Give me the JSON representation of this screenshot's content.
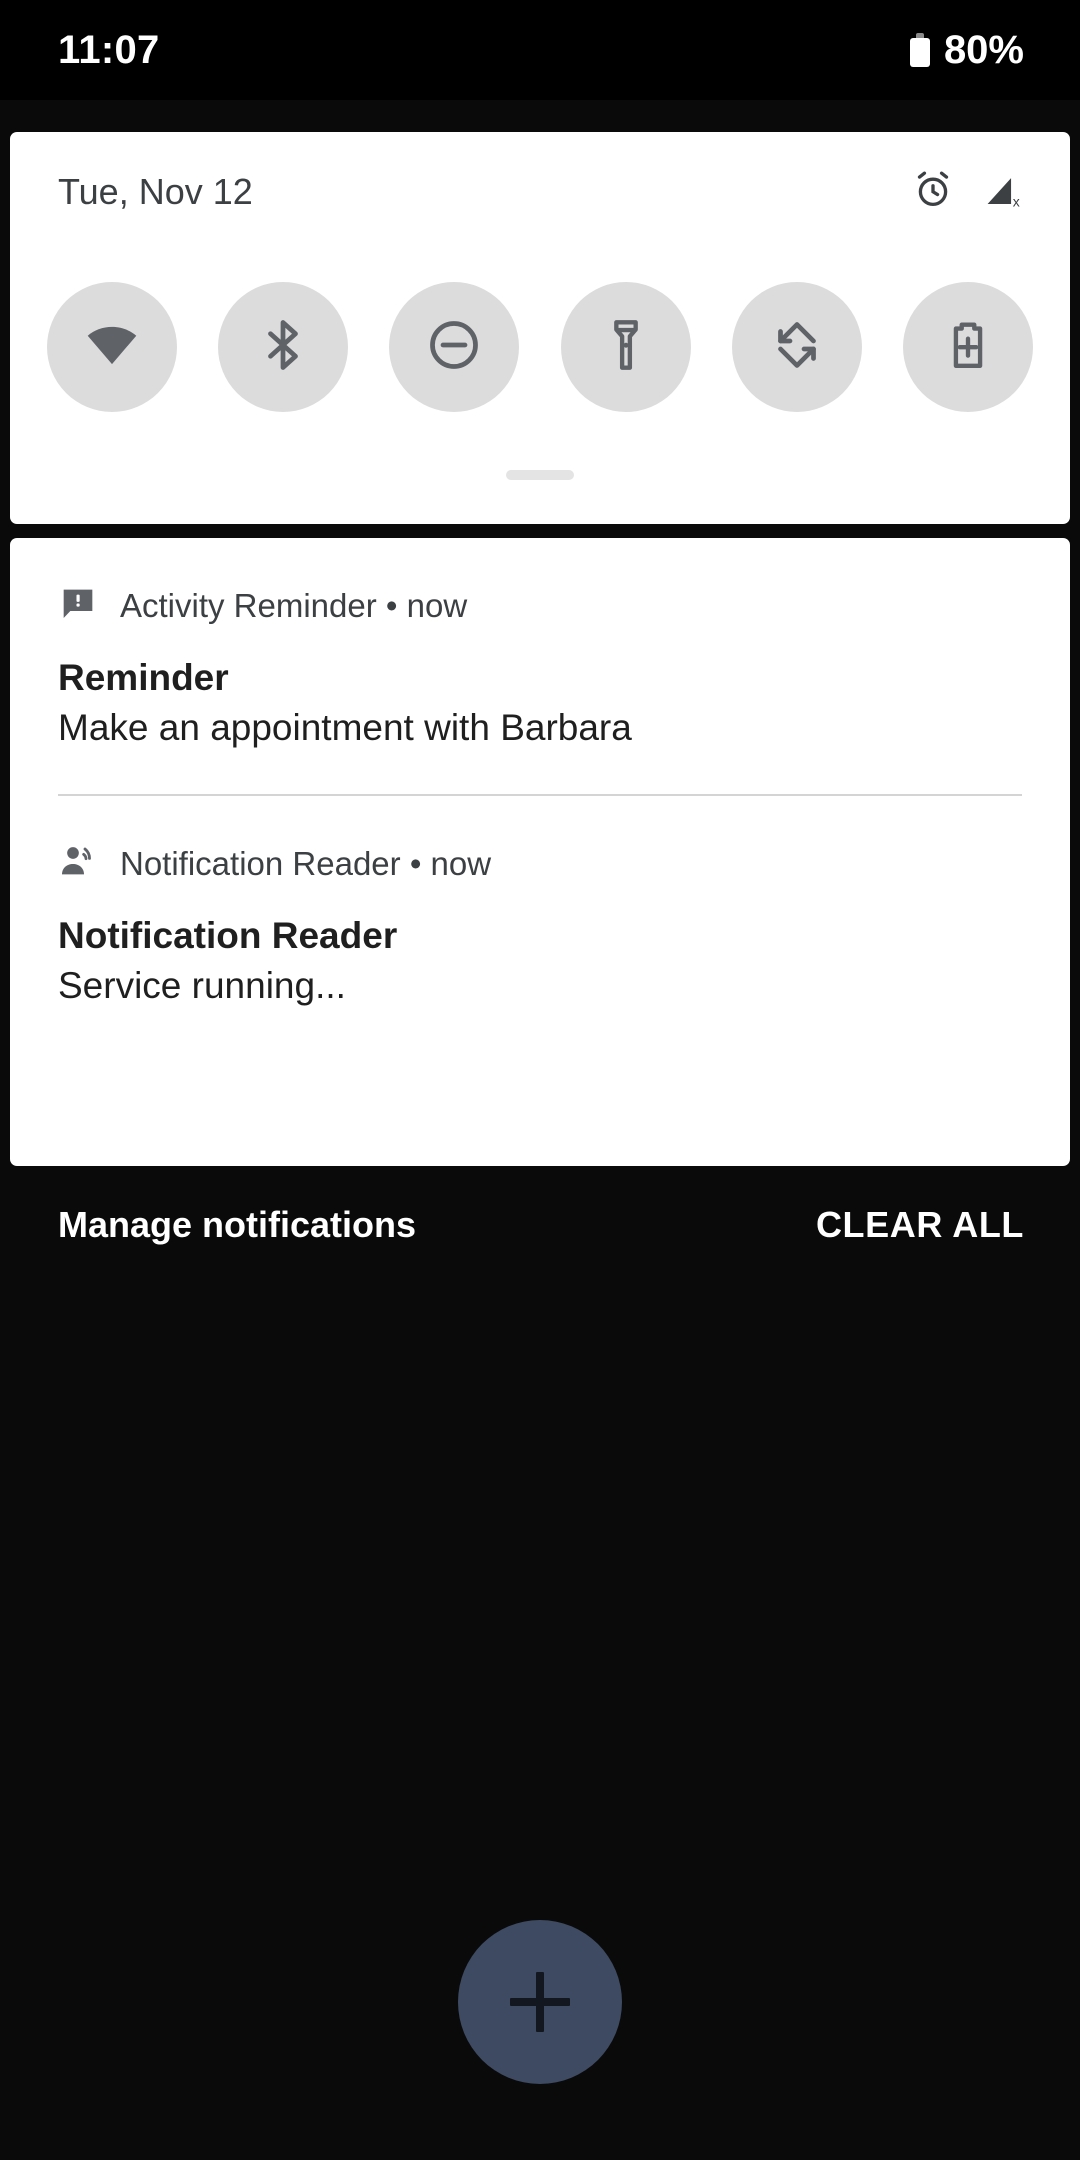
{
  "status_bar": {
    "clock": "11:07",
    "battery_text": "80%",
    "battery_icon": "battery-icon"
  },
  "quick_settings": {
    "date": "Tue, Nov 12",
    "status_icons": [
      {
        "name": "alarm-clock-icon",
        "label": "Alarm set"
      },
      {
        "name": "signal-off-icon",
        "label": "No signal"
      }
    ],
    "tiles": [
      {
        "name": "wifi-tile",
        "icon": "wifi-icon",
        "label": "Wi-Fi"
      },
      {
        "name": "bluetooth-tile",
        "icon": "bluetooth-icon",
        "label": "Bluetooth"
      },
      {
        "name": "do-not-disturb-tile",
        "icon": "do-not-disturb-icon",
        "label": "Do Not Disturb"
      },
      {
        "name": "flashlight-tile",
        "icon": "flashlight-icon",
        "label": "Flashlight"
      },
      {
        "name": "auto-rotate-tile",
        "icon": "auto-rotate-icon",
        "label": "Auto-rotate"
      },
      {
        "name": "battery-saver-tile",
        "icon": "battery-saver-icon",
        "label": "Battery Saver"
      }
    ],
    "drag_handle": "drag-handle"
  },
  "notifications": [
    {
      "app_line": "Activity Reminder • now",
      "app_name": "Activity Reminder",
      "time": "now",
      "icon": "reminder-bubble-icon",
      "title": "Reminder",
      "body": "Make an appointment with Barbara"
    },
    {
      "app_line": "Notification Reader • now",
      "app_name": "Notification Reader",
      "time": "now",
      "icon": "voice-over-icon",
      "title": "Notification Reader",
      "body": "Service running..."
    }
  ],
  "footer": {
    "manage_label": "Manage notifications",
    "clear_label": "CLEAR ALL"
  },
  "fab": {
    "icon": "plus-icon",
    "color": "#3d4a61"
  },
  "colors": {
    "screen_background": "#0a0a0a",
    "status_bar_background": "#000000",
    "panel_background": "#ffffff",
    "tile_background": "#dcdcdc",
    "tile_icon": "#5f6368",
    "primary_text": "#1f1f1f",
    "secondary_text": "#3c4043",
    "divider": "#d4d4d4",
    "fab": "#3d4a61"
  }
}
